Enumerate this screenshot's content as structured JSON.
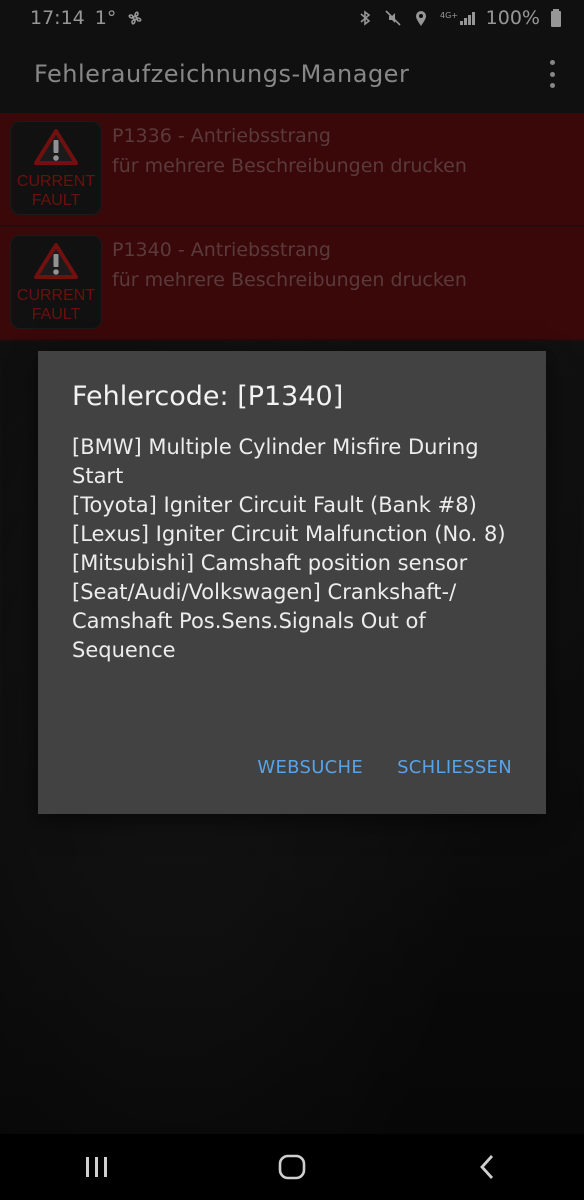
{
  "status_bar": {
    "time": "17:14",
    "temperature": "1°",
    "battery": "100%"
  },
  "app_bar": {
    "title": "Fehleraufzeichnungs-Manager"
  },
  "faults": [
    {
      "code_title": "P1336 - Antriebsstrang",
      "subtitle": "für mehrere Beschreibungen drucken",
      "badge_line1": "CURRENT",
      "badge_line2": "FAULT"
    },
    {
      "code_title": "P1340 - Antriebsstrang",
      "subtitle": "für mehrere Beschreibungen drucken",
      "badge_line1": "CURRENT",
      "badge_line2": "FAULT"
    }
  ],
  "dialog": {
    "title": "Fehlercode: [P1340]",
    "lines": [
      "[BMW] Multiple Cylinder Misfire During Start",
      "[Toyota] Igniter Circuit Fault (Bank #8)",
      "[Lexus] Igniter Circuit Malfunction (No. 8)",
      "[Mitsubishi] Camshaft position sensor",
      "[Seat/Audi/Volkswagen] Crankshaft-/ Camshaft Pos.Sens.Signals Out of Sequence"
    ],
    "button_websearch": "WEBSUCHE",
    "button_close": "SCHLIESSEN"
  },
  "colors": {
    "accent_button": "#5aa2e6",
    "row_bg": "#5a0d0d",
    "dialog_bg": "#424242",
    "fault_red": "#a81818"
  }
}
